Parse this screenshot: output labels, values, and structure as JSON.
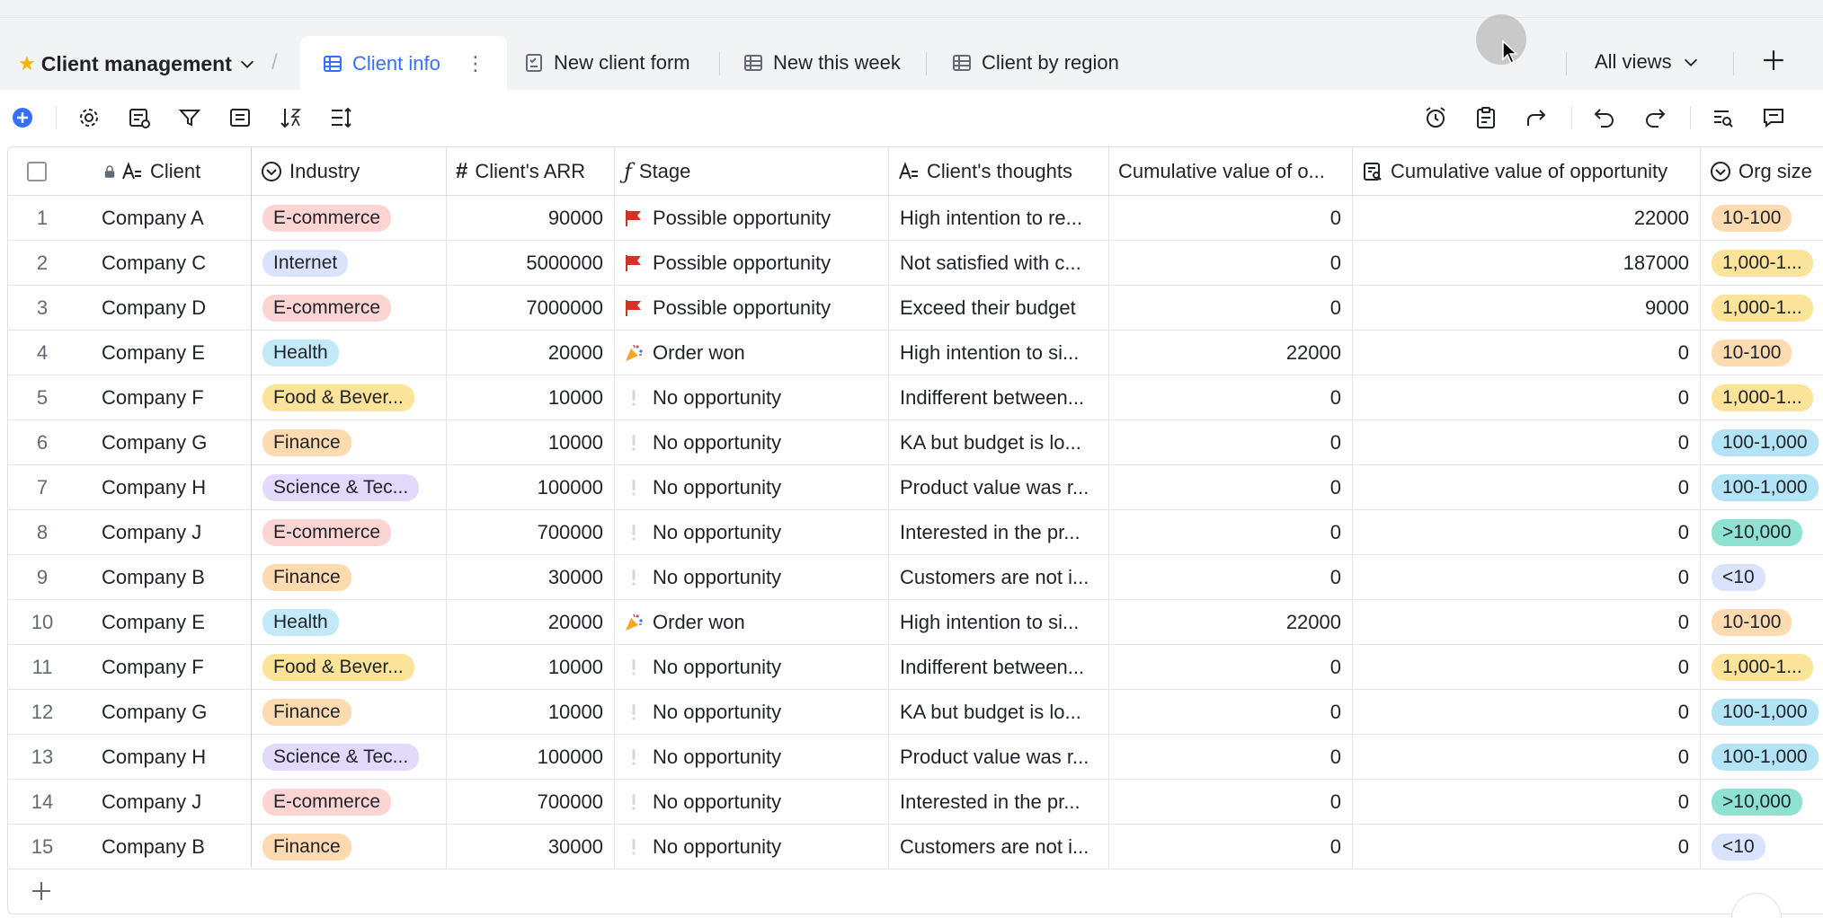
{
  "app": {
    "title": "Client management"
  },
  "tabs": [
    {
      "label": "Client info",
      "active": true
    },
    {
      "label": "New client form"
    },
    {
      "label": "New this week"
    },
    {
      "label": "Client by region"
    }
  ],
  "all_views_label": "All views",
  "columns": [
    {
      "label": "Client",
      "icon": "text-icon"
    },
    {
      "label": "Industry",
      "icon": "single-select-icon"
    },
    {
      "label": "Client's ARR",
      "icon": "number-icon"
    },
    {
      "label": "Stage",
      "icon": "formula-icon"
    },
    {
      "label": "Client's thoughts",
      "icon": "text-icon"
    },
    {
      "label": "Cumulative value of o...",
      "icon": ""
    },
    {
      "label": "Cumulative value of opportunity",
      "icon": "lookup-icon"
    },
    {
      "label": "Org size",
      "icon": "single-select-icon"
    }
  ],
  "colors": {
    "accent": "#3370ff",
    "tag_ecommerce": "#fcd5d2",
    "tag_internet": "#d9e3fc",
    "tag_health": "#c2e9f8",
    "tag_food": "#fbe39a",
    "tag_finance": "#fddab0",
    "tag_science": "#e3d9fb",
    "org_10_100": "#fddab0",
    "org_1000": "#fbe39a",
    "org_100_1000": "#b2e4f6",
    "org_10000": "#8fe2d2",
    "org_lt10": "#d9e3fc"
  },
  "rows": [
    {
      "idx": "1",
      "client": "Company A",
      "industry": "E-commerce",
      "arr": "90000",
      "stage": "Possible opportunity",
      "stage_icon": "red-flag-icon",
      "thoughts": "High intention to re...",
      "cum_o": "0",
      "cum_opp": "22000",
      "org": "10-100"
    },
    {
      "idx": "2",
      "client": "Company C",
      "industry": "Internet",
      "arr": "5000000",
      "stage": "Possible opportunity",
      "stage_icon": "red-flag-icon",
      "thoughts": "Not satisfied with c...",
      "cum_o": "0",
      "cum_opp": "187000",
      "org": "1,000-1..."
    },
    {
      "idx": "3",
      "client": "Company D",
      "industry": "E-commerce",
      "arr": "7000000",
      "stage": "Possible opportunity",
      "stage_icon": "red-flag-icon",
      "thoughts": "Exceed their budget",
      "cum_o": "0",
      "cum_opp": "9000",
      "org": "1,000-1..."
    },
    {
      "idx": "4",
      "client": "Company E",
      "industry": "Health",
      "arr": "20000",
      "stage": "Order won",
      "stage_icon": "party-popper-icon",
      "thoughts": "High intention to si...",
      "cum_o": "22000",
      "cum_opp": "0",
      "org": "10-100"
    },
    {
      "idx": "5",
      "client": "Company F",
      "industry": "Food & Bever...",
      "arr": "10000",
      "stage": "No opportunity",
      "stage_icon": "exclamation-icon",
      "thoughts": "Indifferent between...",
      "cum_o": "0",
      "cum_opp": "0",
      "org": "1,000-1..."
    },
    {
      "idx": "6",
      "client": "Company G",
      "industry": "Finance",
      "arr": "10000",
      "stage": "No opportunity",
      "stage_icon": "exclamation-icon",
      "thoughts": "KA but budget is lo...",
      "cum_o": "0",
      "cum_opp": "0",
      "org": "100-1,000"
    },
    {
      "idx": "7",
      "client": "Company H",
      "industry": "Science & Tec...",
      "arr": "100000",
      "stage": "No opportunity",
      "stage_icon": "exclamation-icon",
      "thoughts": "Product value was r...",
      "cum_o": "0",
      "cum_opp": "0",
      "org": "100-1,000"
    },
    {
      "idx": "8",
      "client": "Company J",
      "industry": "E-commerce",
      "arr": "700000",
      "stage": "No opportunity",
      "stage_icon": "exclamation-icon",
      "thoughts": "Interested in the pr...",
      "cum_o": "0",
      "cum_opp": "0",
      "org": ">10,000"
    },
    {
      "idx": "9",
      "client": "Company B",
      "industry": "Finance",
      "arr": "30000",
      "stage": "No opportunity",
      "stage_icon": "exclamation-icon",
      "thoughts": "Customers are not i...",
      "cum_o": "0",
      "cum_opp": "0",
      "org": "<10"
    },
    {
      "idx": "10",
      "client": "Company E",
      "industry": "Health",
      "arr": "20000",
      "stage": "Order won",
      "stage_icon": "party-popper-icon",
      "thoughts": "High intention to si...",
      "cum_o": "22000",
      "cum_opp": "0",
      "org": "10-100"
    },
    {
      "idx": "11",
      "client": "Company F",
      "industry": "Food & Bever...",
      "arr": "10000",
      "stage": "No opportunity",
      "stage_icon": "exclamation-icon",
      "thoughts": "Indifferent between...",
      "cum_o": "0",
      "cum_opp": "0",
      "org": "1,000-1..."
    },
    {
      "idx": "12",
      "client": "Company G",
      "industry": "Finance",
      "arr": "10000",
      "stage": "No opportunity",
      "stage_icon": "exclamation-icon",
      "thoughts": "KA but budget is lo...",
      "cum_o": "0",
      "cum_opp": "0",
      "org": "100-1,000"
    },
    {
      "idx": "13",
      "client": "Company H",
      "industry": "Science & Tec...",
      "arr": "100000",
      "stage": "No opportunity",
      "stage_icon": "exclamation-icon",
      "thoughts": "Product value was r...",
      "cum_o": "0",
      "cum_opp": "0",
      "org": "100-1,000"
    },
    {
      "idx": "14",
      "client": "Company J",
      "industry": "E-commerce",
      "arr": "700000",
      "stage": "No opportunity",
      "stage_icon": "exclamation-icon",
      "thoughts": "Interested in the pr...",
      "cum_o": "0",
      "cum_opp": "0",
      "org": ">10,000"
    },
    {
      "idx": "15",
      "client": "Company B",
      "industry": "Finance",
      "arr": "30000",
      "stage": "No opportunity",
      "stage_icon": "exclamation-icon",
      "thoughts": "Customers are not i...",
      "cum_o": "0",
      "cum_opp": "0",
      "org": "<10"
    }
  ]
}
